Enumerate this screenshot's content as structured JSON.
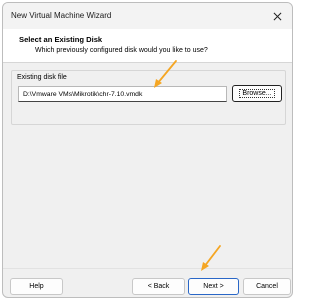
{
  "window": {
    "title": "New Virtual Machine Wizard",
    "close_icon": "close-icon"
  },
  "header": {
    "title": "Select an Existing Disk",
    "subtitle": "Which previously configured disk would you like to use?"
  },
  "disk_group": {
    "label": "Existing disk file",
    "path_value": "D:\\Vmware VMs\\Mikrotik\\chr-7.10.vmdk",
    "browse_label": "Browse..."
  },
  "footer": {
    "help_label": "Help",
    "back_label": "< Back",
    "next_label": "Next >",
    "cancel_label": "Cancel"
  },
  "annotations": {
    "arrow_color": "#f5a623"
  }
}
